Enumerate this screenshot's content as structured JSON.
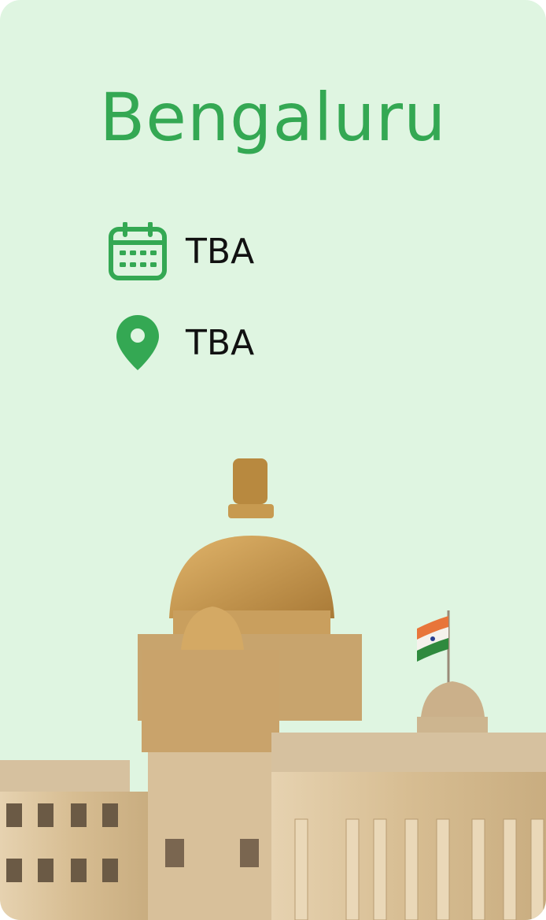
{
  "event": {
    "city": "Bengaluru",
    "date": "TBA",
    "venue": "TBA"
  },
  "icons": {
    "date": "calendar-icon",
    "venue": "location-pin-icon"
  },
  "colors": {
    "card_background": "#dff5e1",
    "accent": "#34a853",
    "text": "#111111"
  }
}
